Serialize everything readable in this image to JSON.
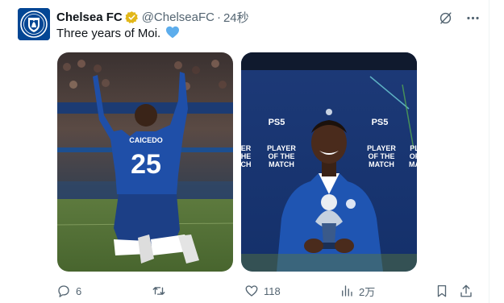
{
  "tweet": {
    "display_name": "Chelsea FC",
    "handle": "@ChelseaFC",
    "separator": "·",
    "time": "24秒",
    "text": "Three years of Moi.",
    "emoji": "blue-heart",
    "verified_badge": "gold-verified-icon"
  },
  "images": [
    {
      "jersey_name": "CAICEDO",
      "jersey_number": "25",
      "description_icon": "player-kneeling-photo"
    },
    {
      "sponsor_left": "PS5",
      "sponsor_right": "PS5",
      "award_left": [
        "PLAYER",
        "OF THE",
        "MATCH"
      ],
      "award_right": [
        "PLAYER",
        "OF THE",
        "MATCH"
      ],
      "edge_left": [
        "ER",
        "HE",
        "CH"
      ],
      "edge_right": [
        "PL",
        "OF",
        "MA"
      ]
    }
  ],
  "actions": {
    "reply_count": "6",
    "retweet_count": "",
    "like_count": "118",
    "views_count": "2万"
  },
  "colors": {
    "chelsea_blue": "#034694",
    "text_primary": "#0f1419",
    "text_secondary": "#536471",
    "verified_gold": "#e2b719",
    "heart_blue": "#5dadec"
  }
}
